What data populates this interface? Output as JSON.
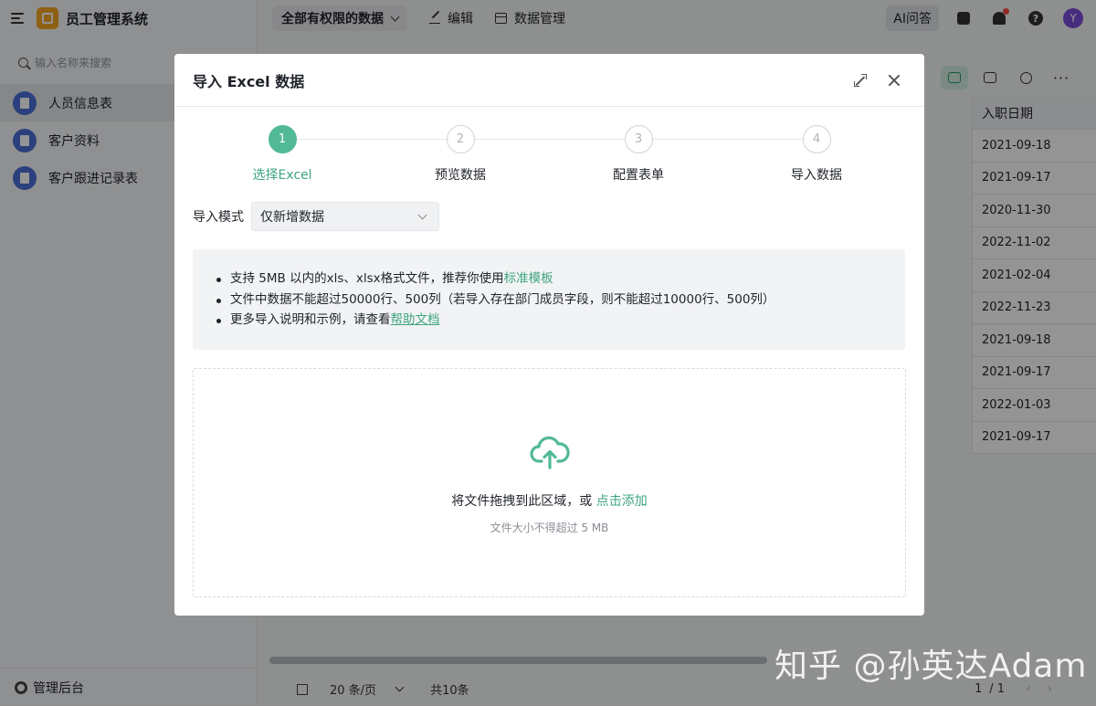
{
  "app": {
    "name": "员工管理系统",
    "sidebar_search_placeholder": "输入名称来搜索",
    "sidebar_items": [
      {
        "label": "人员信息表",
        "active": true
      },
      {
        "label": "客户资料",
        "active": false
      },
      {
        "label": "客户跟进记录表",
        "active": false
      }
    ],
    "footer_label": "管理后台"
  },
  "topbar": {
    "view_select": "全部有权限的数据",
    "edit_label": "编辑",
    "data_manage_label": "数据管理",
    "ai_label": "AI问答",
    "help_glyph": "?",
    "avatar_letter": "Y"
  },
  "table": {
    "date_header": "入职日期",
    "dates": [
      "2021-09-18",
      "2021-09-17",
      "2020-11-30",
      "2022-11-02",
      "2021-02-04",
      "2022-11-23",
      "2021-09-18",
      "2021-09-17",
      "2022-01-03",
      "2021-09-17"
    ]
  },
  "pager": {
    "page_size": "20 条/页",
    "total": "共10条",
    "current_page": "1",
    "page_total": "/ 1",
    "prev_glyph": "‹",
    "next_glyph": "›"
  },
  "modal": {
    "title": "导入 Excel 数据",
    "steps": [
      {
        "num": "1",
        "label": "选择Excel",
        "active": true
      },
      {
        "num": "2",
        "label": "预览数据",
        "active": false
      },
      {
        "num": "3",
        "label": "配置表单",
        "active": false
      },
      {
        "num": "4",
        "label": "导入数据",
        "active": false
      }
    ],
    "mode_label": "导入模式",
    "mode_value": "仅新增数据",
    "notice": {
      "line1_prefix": "支持 5MB 以内的xls、xlsx格式文件，推荐你使用",
      "line1_link": "标准模板",
      "line2": "文件中数据不能超过50000行、500列（若导入存在部门成员字段，则不能超过10000行、500列）",
      "line3_prefix": "更多导入说明和示例，请查看",
      "line3_link": "帮助文档"
    },
    "dropzone": {
      "main_prefix": "将文件拖拽到此区域，或 ",
      "main_link": "点击添加",
      "sub": "文件大小不得超过 5 MB"
    }
  },
  "watermark": "知乎 @孙英达Adam",
  "colors": {
    "accent": "#52b996",
    "link": "#3ea57f",
    "overlay": "rgba(0,0,0,0.42)"
  }
}
